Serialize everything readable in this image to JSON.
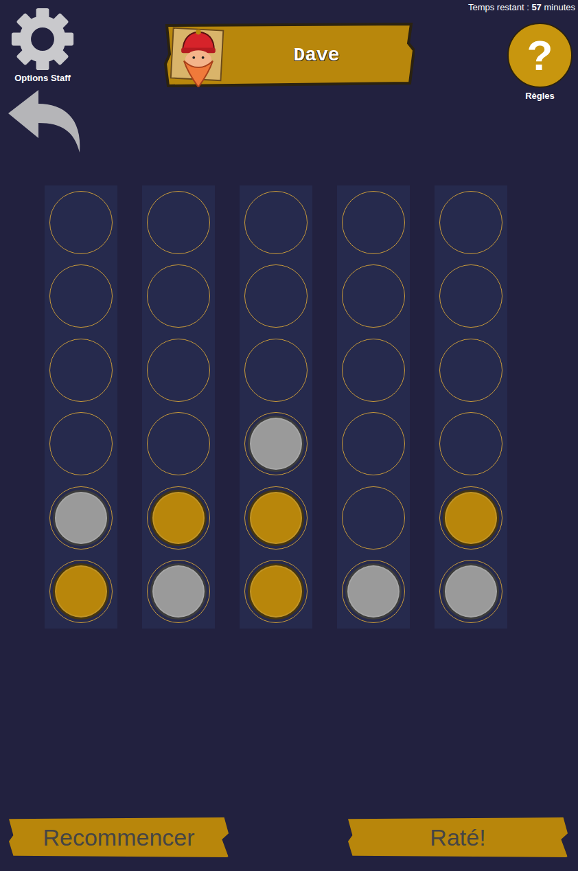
{
  "header": {
    "timer": {
      "label": "Temps restant :",
      "value": "57",
      "unit": "minutes"
    },
    "staff_options": {
      "label": "Options Staff"
    },
    "player": {
      "name": "Dave"
    },
    "rules": {
      "icon": "?",
      "label": "Règles"
    }
  },
  "board": {
    "columns": [
      {
        "cells": [
          {
            "filled": false
          },
          {
            "filled": false
          },
          {
            "filled": false
          },
          {
            "filled": false
          },
          {
            "filled": true,
            "color": "#9a9a9a"
          },
          {
            "filled": true,
            "color": "#b8860b"
          }
        ]
      },
      {
        "cells": [
          {
            "filled": false
          },
          {
            "filled": false
          },
          {
            "filled": false
          },
          {
            "filled": false
          },
          {
            "filled": true,
            "color": "#b8860b"
          },
          {
            "filled": true,
            "color": "#9a9a9a"
          }
        ]
      },
      {
        "cells": [
          {
            "filled": false
          },
          {
            "filled": false
          },
          {
            "filled": false
          },
          {
            "filled": true,
            "color": "#9a9a9a"
          },
          {
            "filled": true,
            "color": "#b8860b"
          },
          {
            "filled": true,
            "color": "#b8860b"
          }
        ]
      },
      {
        "cells": [
          {
            "filled": false
          },
          {
            "filled": false
          },
          {
            "filled": false
          },
          {
            "filled": false
          },
          {
            "filled": false
          },
          {
            "filled": true,
            "color": "#9a9a9a"
          }
        ]
      },
      {
        "cells": [
          {
            "filled": false
          },
          {
            "filled": false
          },
          {
            "filled": false
          },
          {
            "filled": false
          },
          {
            "filled": true,
            "color": "#b8860b"
          },
          {
            "filled": true,
            "color": "#9a9a9a"
          }
        ]
      }
    ]
  },
  "buttons": [
    "Recommencer",
    "Raté!"
  ]
}
